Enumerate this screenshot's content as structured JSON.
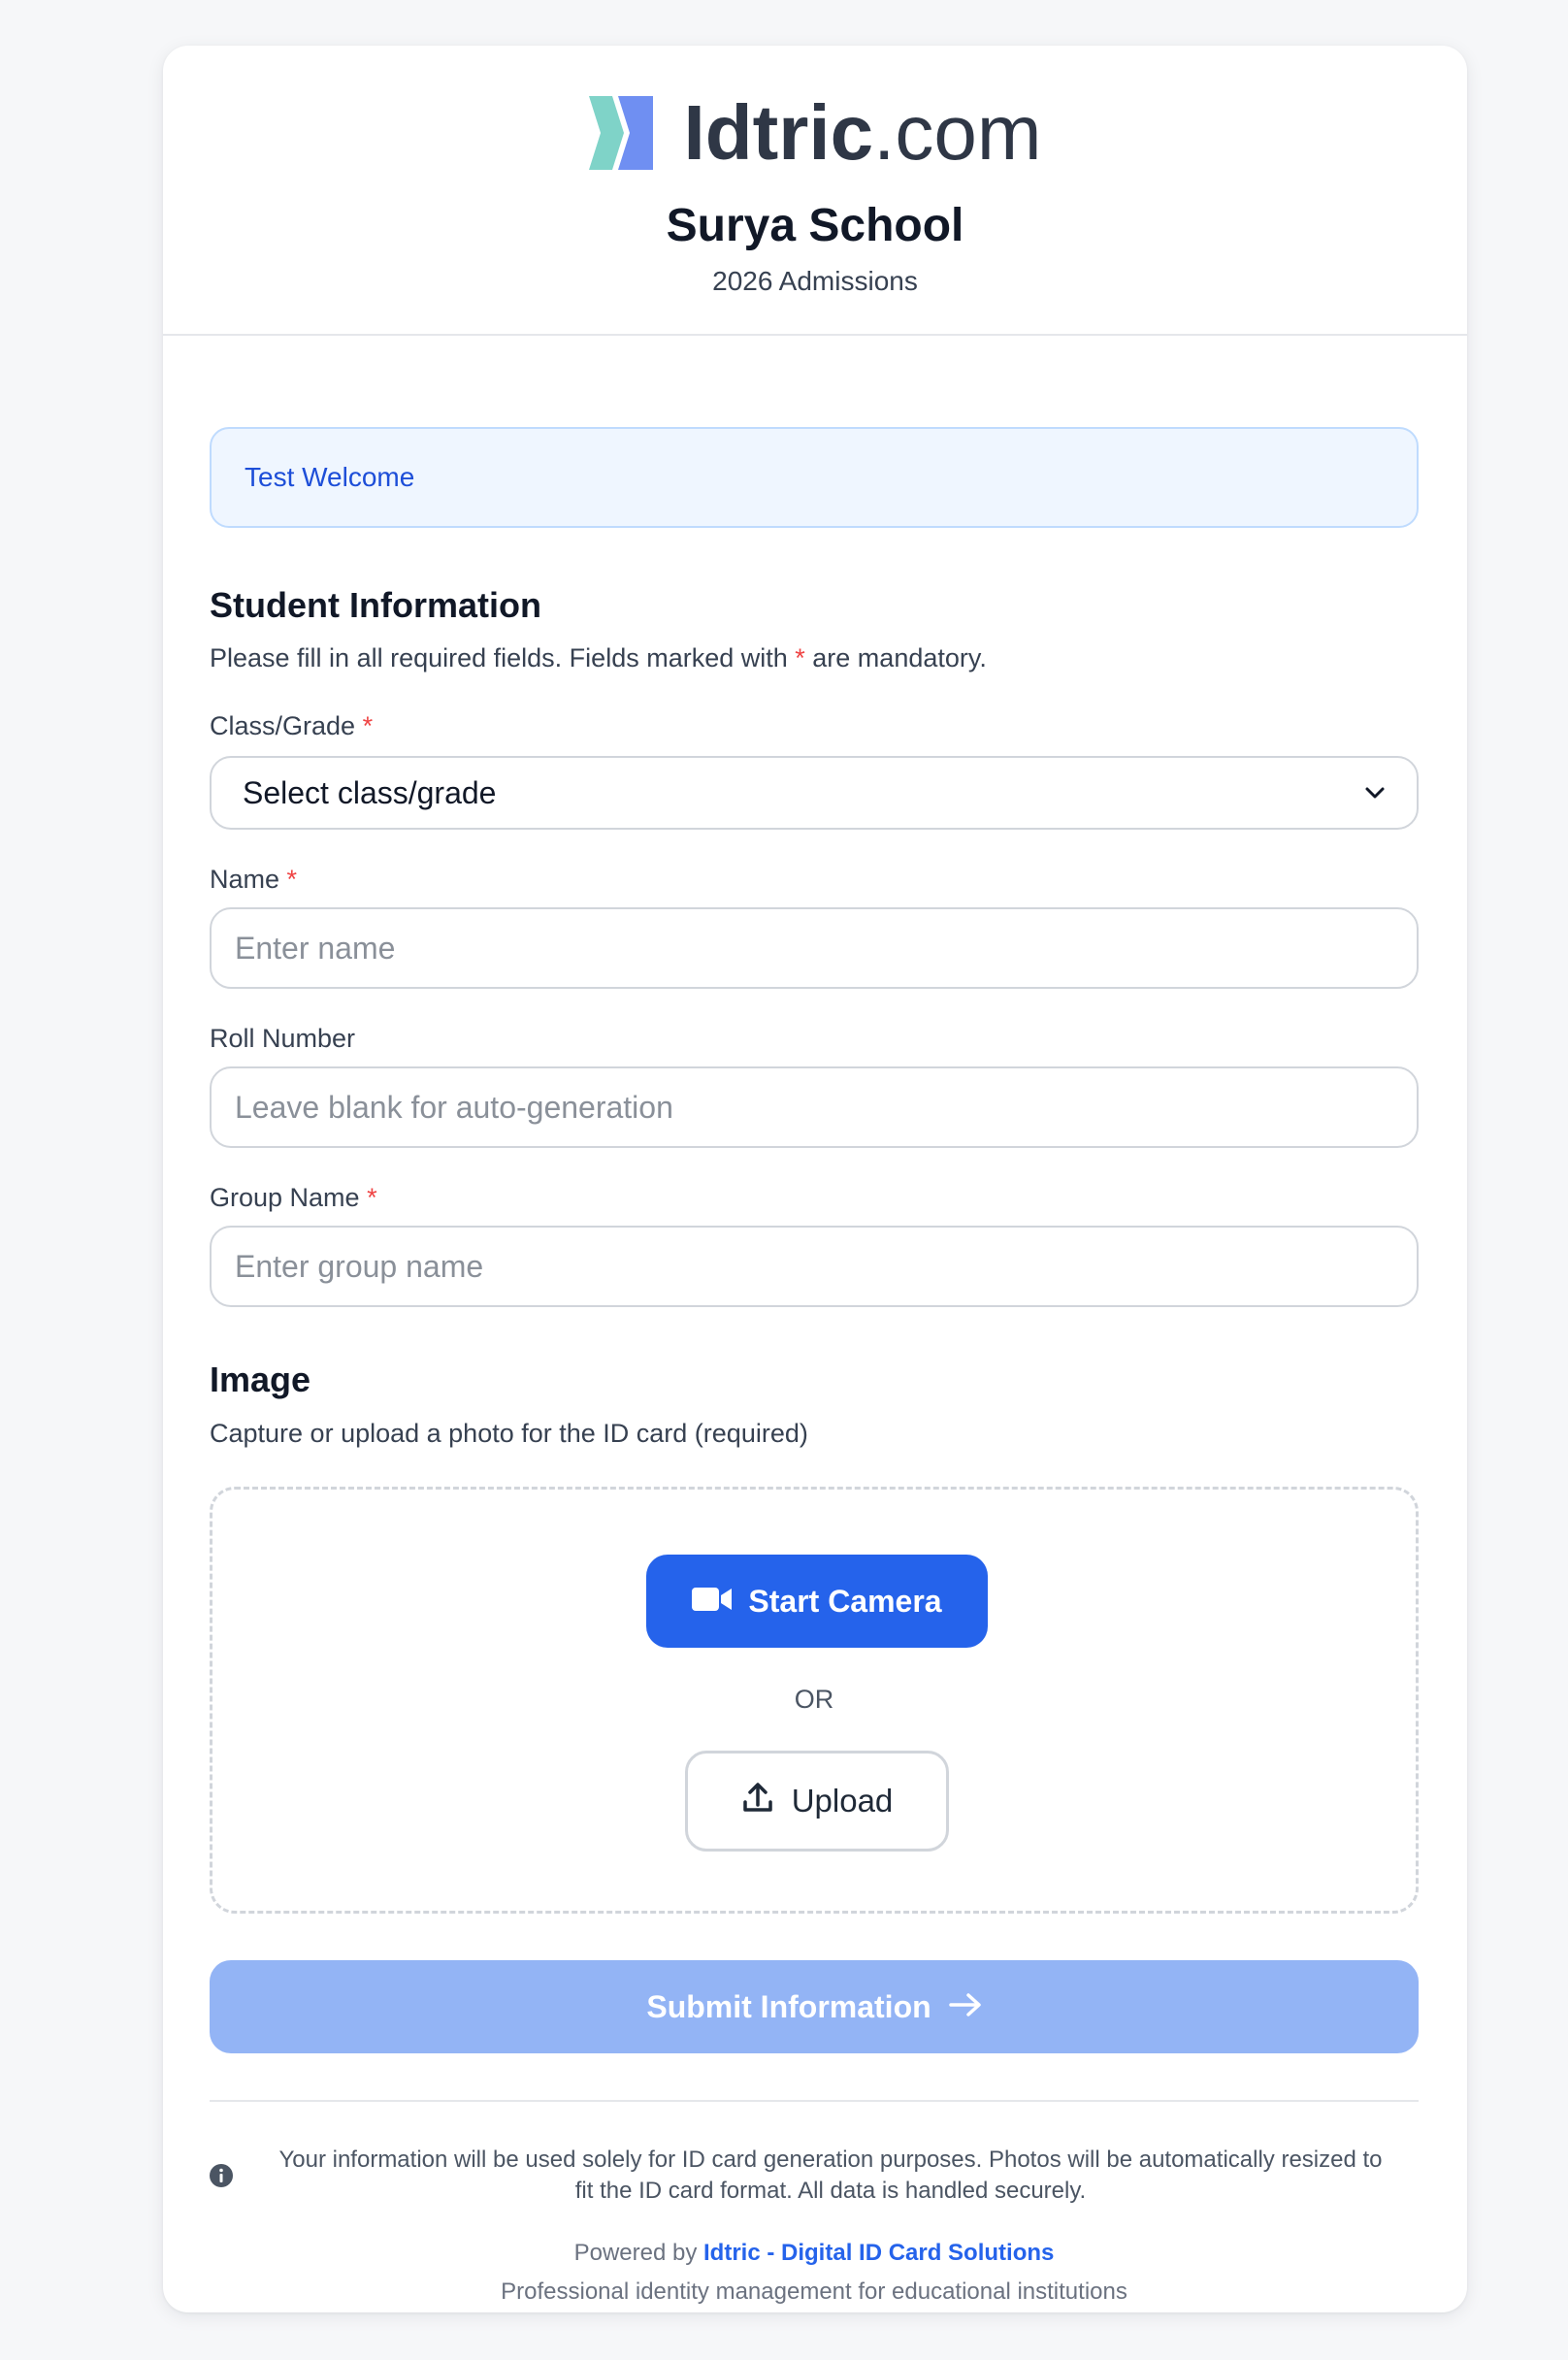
{
  "header": {
    "logo_bold": "Idtric",
    "logo_light": ".com",
    "school_name": "Surya School",
    "subtitle": "2026 Admissions"
  },
  "welcome_message": "Test Welcome",
  "student_section": {
    "title": "Student Information",
    "desc_before": "Please fill in all required fields. Fields marked with ",
    "required_mark": "*",
    "desc_after": " are mandatory."
  },
  "fields": {
    "class_grade": {
      "label": "Class/Grade",
      "required": "*",
      "selected": "Select class/grade"
    },
    "name": {
      "label": "Name",
      "required": "*",
      "placeholder": "Enter name"
    },
    "roll_number": {
      "label": "Roll Number",
      "placeholder": "Leave blank for auto-generation"
    },
    "group_name": {
      "label": "Group Name",
      "required": "*",
      "placeholder": "Enter group name"
    }
  },
  "image_section": {
    "title": "Image",
    "desc": "Capture or upload a photo for the ID card (required)",
    "camera_label": "Start Camera",
    "or_text": "OR",
    "upload_label": "Upload"
  },
  "submit_label": "Submit Information",
  "footer": {
    "privacy_line1": "Your information will be used solely for ID card generation purposes. Photos will be automatically resized to",
    "privacy_line2": "fit the ID card format. All data is handled securely.",
    "powered_prefix": "Powered by ",
    "powered_link": "Idtric - Digital ID Card Solutions",
    "tagline": "Professional identity management for educational institutions"
  },
  "colors": {
    "primary": "#2563eb",
    "submit_disabled": "#93b4f5",
    "logo_teal": "#7fd3c8",
    "logo_blue": "#6f8ff2",
    "required": "#ef4444"
  },
  "icons": {
    "logo": "idtric-logo-mark",
    "camera": "video-camera-icon",
    "upload": "upload-icon",
    "submit": "arrow-right-icon",
    "select": "chevron-down-icon",
    "info": "info-icon"
  }
}
